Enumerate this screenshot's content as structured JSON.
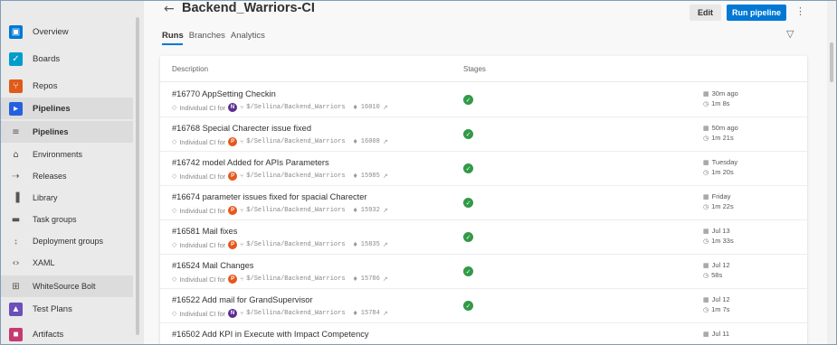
{
  "sidebar": {
    "items": [
      {
        "label": "Overview",
        "icon": "overview-icon",
        "color": "#0078d4",
        "top": true
      },
      {
        "label": "Boards",
        "icon": "boards-icon",
        "color": "#009ccc",
        "top": true
      },
      {
        "label": "Repos",
        "icon": "repos-icon",
        "color": "#e05b1a",
        "top": true
      },
      {
        "label": "Pipelines",
        "icon": "pipelines-icon",
        "color": "#2560e0",
        "top": true,
        "selected": true
      },
      {
        "label": "Pipelines",
        "icon": "pipelines-sub-icon",
        "selected": true,
        "bold": true
      },
      {
        "label": "Environments",
        "icon": "environments-icon"
      },
      {
        "label": "Releases",
        "icon": "releases-icon"
      },
      {
        "label": "Library",
        "icon": "library-icon"
      },
      {
        "label": "Task groups",
        "icon": "task-groups-icon"
      },
      {
        "label": "Deployment groups",
        "icon": "deployment-groups-icon"
      },
      {
        "label": "XAML",
        "icon": "xaml-icon"
      },
      {
        "label": "WhiteSource Bolt",
        "icon": "whitesource-bolt-icon",
        "selected": true
      },
      {
        "label": "Test Plans",
        "icon": "test-plans-icon",
        "color": "#6b4fbb",
        "top": true
      },
      {
        "label": "Artifacts",
        "icon": "artifacts-icon",
        "color": "#c63a70",
        "top": true
      }
    ]
  },
  "header": {
    "title": "Backend_Warriors-CI",
    "edit_label": "Edit",
    "run_label": "Run pipeline",
    "tabs": [
      "Runs",
      "Branches",
      "Analytics"
    ]
  },
  "table": {
    "columns": [
      "Description",
      "Stages"
    ],
    "rows": [
      {
        "title": "#16770 AppSetting Checkin",
        "trigger": "Individual CI for",
        "avatar": "N",
        "avatar_color": "#5c2d91",
        "branch": "$/Sellina/Backend_Warriors",
        "changeset": "16010",
        "when": "30m ago",
        "duration": "1m 8s"
      },
      {
        "title": "#16768 Special Charecter issue fixed",
        "trigger": "Individual CI for",
        "avatar": "P",
        "avatar_color": "#e6571c",
        "branch": "$/Sellina/Backend_Warriors",
        "changeset": "16008",
        "when": "50m ago",
        "duration": "1m 21s"
      },
      {
        "title": "#16742 model Added for APIs Parameters",
        "trigger": "Individual CI for",
        "avatar": "P",
        "avatar_color": "#e6571c",
        "branch": "$/Sellina/Backend_Warriors",
        "changeset": "15985",
        "when": "Tuesday",
        "duration": "1m 20s"
      },
      {
        "title": "#16674 parameter issues fixed for spacial Charecter",
        "trigger": "Individual CI for",
        "avatar": "P",
        "avatar_color": "#e6571c",
        "branch": "$/Sellina/Backend_Warriors",
        "changeset": "15932",
        "when": "Friday",
        "duration": "1m 22s"
      },
      {
        "title": "#16581 Mail fixes",
        "trigger": "Individual CI for",
        "avatar": "P",
        "avatar_color": "#e6571c",
        "branch": "$/Sellina/Backend_Warriors",
        "changeset": "15835",
        "when": "Jul 13",
        "duration": "1m 33s"
      },
      {
        "title": "#16524 Mail Changes",
        "trigger": "Individual CI for",
        "avatar": "P",
        "avatar_color": "#e6571c",
        "branch": "$/Sellina/Backend_Warriors",
        "changeset": "15786",
        "when": "Jul 12",
        "duration": "58s"
      },
      {
        "title": "#16522 Add mail for GrandSupervisor",
        "trigger": "Individual CI for",
        "avatar": "N",
        "avatar_color": "#5c2d91",
        "branch": "$/Sellina/Backend_Warriors",
        "changeset": "15784",
        "when": "Jul 12",
        "duration": "1m 7s"
      },
      {
        "title": "#16502 Add KPI in Execute with Impact Competency",
        "trigger": "",
        "avatar": "",
        "avatar_color": "",
        "branch": "",
        "changeset": "",
        "when": "Jul 11",
        "duration": ""
      }
    ]
  }
}
